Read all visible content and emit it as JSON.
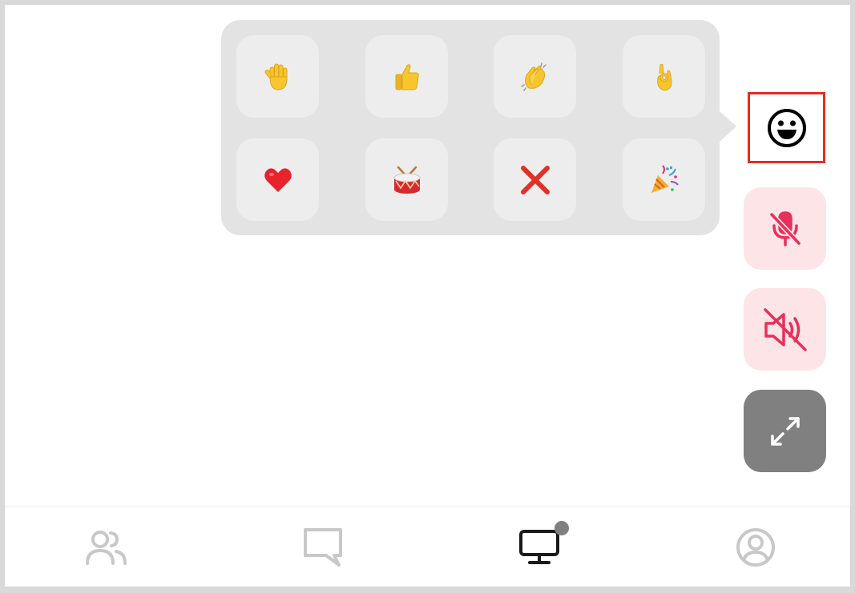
{
  "popover": {
    "reactions": [
      {
        "name": "raised-hand",
        "glyph": "✋"
      },
      {
        "name": "thumbs-up",
        "glyph": "👍"
      },
      {
        "name": "clapping-hands",
        "glyph": "👏"
      },
      {
        "name": "ok-hand",
        "glyph": "👌"
      },
      {
        "name": "red-heart",
        "glyph": "❤️"
      },
      {
        "name": "drum",
        "glyph": "🥁"
      },
      {
        "name": "cross-mark",
        "glyph": "❌"
      },
      {
        "name": "party-popper",
        "glyph": "🎉"
      }
    ]
  },
  "controls": {
    "reaction_toggle": {
      "icon": "smiley-face-icon",
      "highlighted": true
    },
    "microphone": {
      "icon": "microphone-off-icon",
      "state": "muted"
    },
    "speaker": {
      "icon": "speaker-off-icon",
      "state": "muted"
    },
    "fullscreen": {
      "icon": "expand-icon"
    }
  },
  "bottom_nav": {
    "items": [
      {
        "icon": "participants-icon",
        "active": false
      },
      {
        "icon": "chat-icon",
        "active": false
      },
      {
        "icon": "screen-share-icon",
        "active": true,
        "has_badge": true
      },
      {
        "icon": "profile-icon",
        "active": false
      }
    ]
  },
  "colors": {
    "highlight_border": "#e0301e",
    "muted_bg": "#fde4e6",
    "muted_icon": "#e8305a",
    "fullscreen_bg": "#808080",
    "nav_inactive": "#c8c8c8",
    "nav_active": "#1a1a1a"
  }
}
